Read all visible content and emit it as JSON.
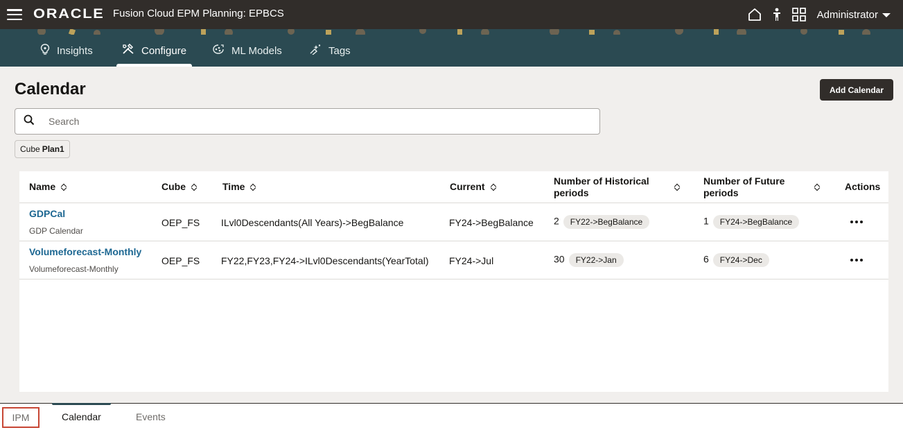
{
  "topbar": {
    "logo": "ORACLE",
    "app_title": "Fusion Cloud EPM Planning:  EPBCS",
    "user": "Administrator",
    "icons": [
      "hamburger-icon",
      "home-icon",
      "accessibility-icon",
      "navigator-icon",
      "chevron-down-icon"
    ]
  },
  "nav": {
    "tabs": [
      {
        "label": "Insights",
        "icon": "insights-icon"
      },
      {
        "label": "Configure",
        "icon": "configure-icon",
        "active": true
      },
      {
        "label": "ML Models",
        "icon": "ml-models-icon"
      },
      {
        "label": "Tags",
        "icon": "tags-icon"
      }
    ]
  },
  "page": {
    "title": "Calendar",
    "add_button": "Add Calendar",
    "search_placeholder": "Search",
    "filter_chip": {
      "label": "Cube",
      "value": "Plan1"
    }
  },
  "table": {
    "headers": {
      "name": "Name",
      "cube": "Cube",
      "time": "Time",
      "current": "Current",
      "historical": "Number of Historical periods",
      "future": "Number of Future periods",
      "actions": "Actions"
    },
    "rows": [
      {
        "name": "GDPCal",
        "description": "GDP Calendar",
        "cube": "OEP_FS",
        "time": "ILvl0Descendants(All Years)->BegBalance",
        "current": "FY24->BegBalance",
        "historical_count": "2",
        "historical_start": "FY22->BegBalance",
        "future_count": "1",
        "future_end": "FY24->BegBalance"
      },
      {
        "name": "Volumeforecast-Monthly",
        "description": "Volumeforecast-Monthly",
        "cube": "OEP_FS",
        "time": "FY22,FY23,FY24->ILvl0Descendants(YearTotal)",
        "current": "FY24->Jul",
        "historical_count": "30",
        "historical_start": "FY22->Jan",
        "future_count": "6",
        "future_end": "FY24->Dec"
      }
    ]
  },
  "bottom_tabs": {
    "ipm": "IPM",
    "calendar": "Calendar",
    "events": "Events"
  },
  "colors": {
    "topbar": "#312d2a",
    "nav": "#2b4a52",
    "link": "#1d6792",
    "highlight_box": "#c74634"
  }
}
